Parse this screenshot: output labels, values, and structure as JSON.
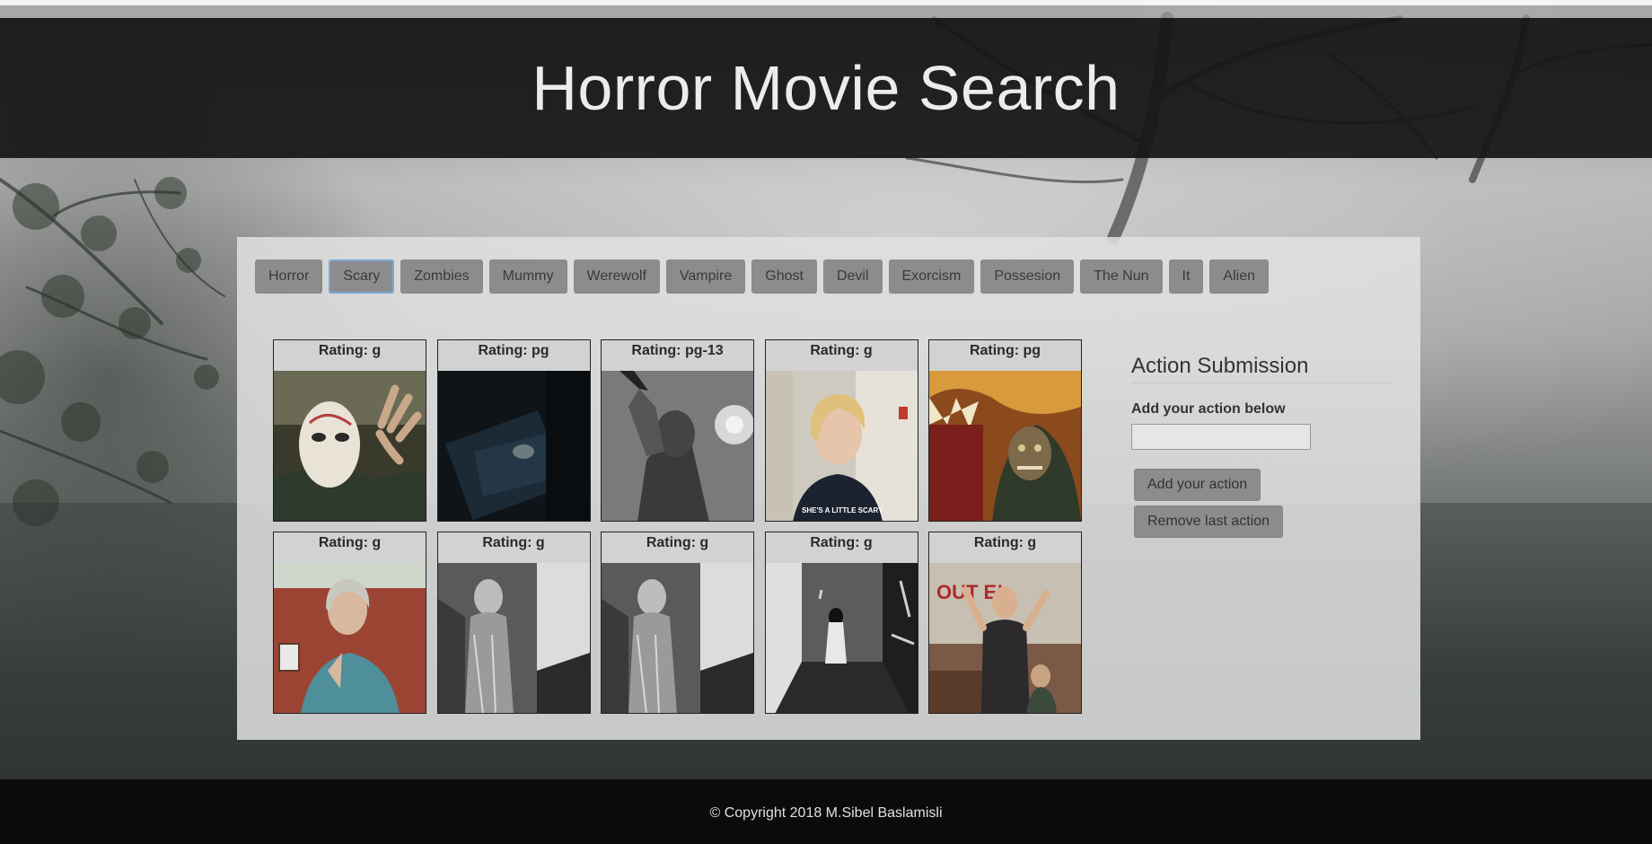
{
  "header": {
    "title": "Horror Movie Search"
  },
  "topics": [
    {
      "label": "Horror",
      "selected": false
    },
    {
      "label": "Scary",
      "selected": true
    },
    {
      "label": "Zombies",
      "selected": false
    },
    {
      "label": "Mummy",
      "selected": false
    },
    {
      "label": "Werewolf",
      "selected": false
    },
    {
      "label": "Vampire",
      "selected": false
    },
    {
      "label": "Ghost",
      "selected": false
    },
    {
      "label": "Devil",
      "selected": false
    },
    {
      "label": "Exorcism",
      "selected": false
    },
    {
      "label": "Possesion",
      "selected": false
    },
    {
      "label": "The Nun",
      "selected": false
    },
    {
      "label": "It",
      "selected": false
    },
    {
      "label": "Alien",
      "selected": false
    }
  ],
  "results": [
    {
      "rating": "Rating: g"
    },
    {
      "rating": "Rating: pg"
    },
    {
      "rating": "Rating: pg-13"
    },
    {
      "rating": "Rating: g",
      "caption": "SHE'S A LITTLE SCARY"
    },
    {
      "rating": "Rating: pg"
    },
    {
      "rating": "Rating: g"
    },
    {
      "rating": "Rating: g"
    },
    {
      "rating": "Rating: g"
    },
    {
      "rating": "Rating: g"
    },
    {
      "rating": "Rating: g",
      "sign_text": "OUT E!"
    }
  ],
  "action_form": {
    "title": "Action Submission",
    "label": "Add your action below",
    "input_value": "",
    "input_placeholder": "",
    "add_button": "Add your action",
    "remove_button": "Remove last action"
  },
  "footer": {
    "copyright": "© Copyright 2018 M.Sibel Baslamisli"
  },
  "colors": {
    "header_bg": "#161618",
    "button_bg": "#8c8c8c",
    "selected_outline": "#7aa6d8",
    "footer_bg": "#0b0b0b"
  }
}
